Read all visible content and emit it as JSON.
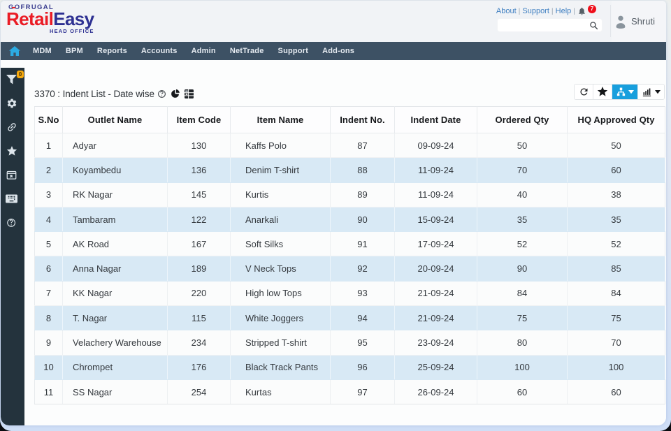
{
  "logo": {
    "brand": "GOFRUGAL",
    "product_part1": "Retail",
    "product_part2": "Easy",
    "office_label": "HEAD OFFICE"
  },
  "header": {
    "links": [
      "About",
      "Support",
      "Help"
    ],
    "separator": "|",
    "notification": {
      "icon": "bell-icon",
      "badge_count": "7"
    },
    "search": {
      "value": "",
      "placeholder": "",
      "icon": "search-icon"
    },
    "user": {
      "name": "Shruti",
      "icon": "user-avatar-icon"
    }
  },
  "nav": {
    "home_icon": "home-icon",
    "items": [
      "MDM",
      "BPM",
      "Reports",
      "Accounts",
      "Admin",
      "NetTrade",
      "Support",
      "Add-ons"
    ]
  },
  "sidebar": {
    "filter_badge": "0",
    "icons": [
      "filter-icon",
      "settings-gear-icon",
      "link-icon",
      "star-icon",
      "external-window-icon",
      "keyboard-icon",
      "help-circle-icon"
    ]
  },
  "report": {
    "title": "3370 : Indent List - Date wise",
    "title_icons": [
      "help-circle-icon",
      "pie-chart-icon",
      "table-grid-icon"
    ],
    "toolbar_buttons": [
      "refresh",
      "favorite",
      "hierarchy-view",
      "chart-view"
    ],
    "toolbar_active": "hierarchy-view"
  },
  "table": {
    "columns": [
      "S.No",
      "Outlet Name",
      "Item Code",
      "Item Name",
      "Indent No.",
      "Indent Date",
      "Ordered Qty",
      "HQ Approved Qty"
    ],
    "rows": [
      [
        "1",
        "Adyar",
        "130",
        "Kaffs Polo",
        "87",
        "09-09-24",
        "50",
        "50"
      ],
      [
        "2",
        "Koyambedu",
        "136",
        "Denim T-shirt",
        "88",
        "11-09-24",
        "70",
        "60"
      ],
      [
        "3",
        "RK Nagar",
        "145",
        "Kurtis",
        "89",
        "11-09-24",
        "40",
        "38"
      ],
      [
        "4",
        "Tambaram",
        "122",
        "Anarkali",
        "90",
        "15-09-24",
        "35",
        "35"
      ],
      [
        "5",
        "AK Road",
        "167",
        "Soft Silks",
        "91",
        "17-09-24",
        "52",
        "52"
      ],
      [
        "6",
        "Anna Nagar",
        "189",
        "V Neck Tops",
        "92",
        "20-09-24",
        "90",
        "85"
      ],
      [
        "7",
        "KK Nagar",
        "220",
        "High low Tops",
        "93",
        "21-09-24",
        "84",
        "84"
      ],
      [
        "8",
        "T. Nagar",
        "115",
        "White Joggers",
        "94",
        "21-09-24",
        "75",
        "75"
      ],
      [
        "9",
        "Velachery Warehouse",
        "234",
        "Stripped T-shirt",
        "95",
        "23-09-24",
        "80",
        "70"
      ],
      [
        "10",
        "Chrompet",
        "176",
        "Black Track Pants",
        "96",
        "25-09-24",
        "100",
        "100"
      ],
      [
        "11",
        "SS Nagar",
        "254",
        "Kurtas",
        "97",
        "26-09-24",
        "60",
        "60"
      ]
    ]
  },
  "colors": {
    "navbar": "#3d5164",
    "sidebar_rail": "#24333d",
    "accent_blue": "#189fdd",
    "home_blue": "#2cabe2",
    "zebra_row": "#d8e9f5",
    "badge_orange": "#f6a90d",
    "badge_red": "#ef0e1a",
    "logo_red": "#ea1c25",
    "logo_indigo": "#2e3192",
    "link_blue": "#3f7fc1"
  }
}
